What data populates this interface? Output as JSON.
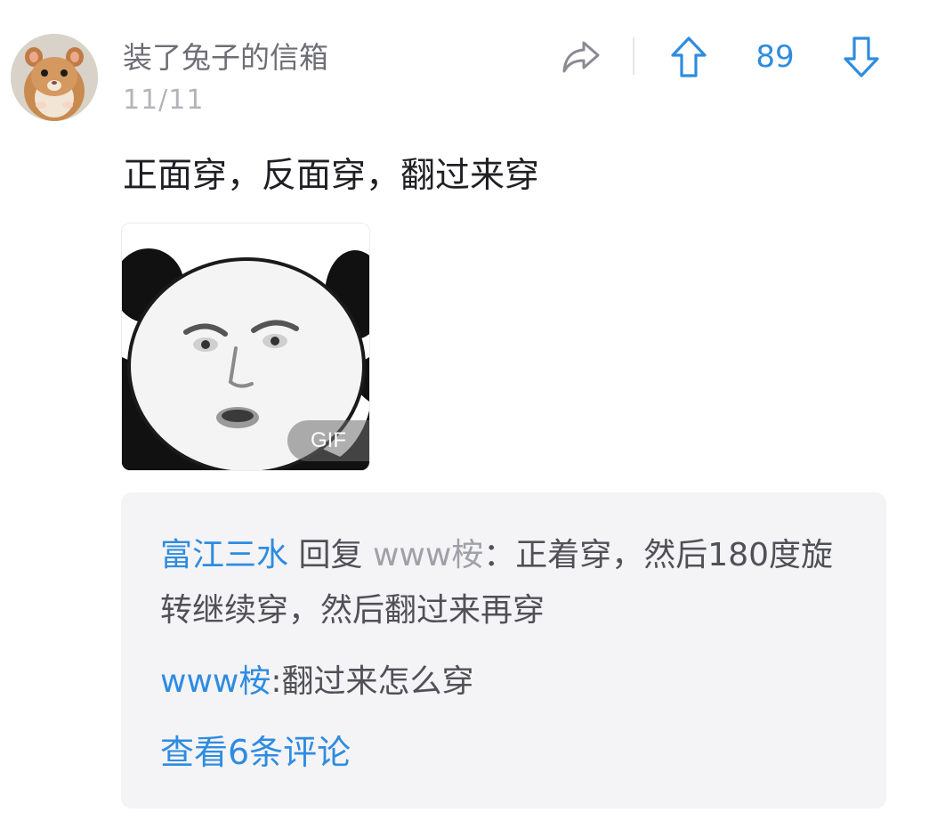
{
  "post": {
    "author": "装了兔子的信箱",
    "date": "11/11",
    "content": "正面穿，反面穿，翻过来穿",
    "avatar_icon": "hamster-avatar",
    "media": {
      "badge": "GIF",
      "icon": "panda-meme-gif"
    }
  },
  "actions": {
    "share_icon": "share-icon",
    "upvote_icon": "arrow-up-icon",
    "vote_count": "89",
    "downvote_icon": "arrow-down-icon"
  },
  "comments": {
    "reply": {
      "author": "富江三水",
      "verb": "回复",
      "target": "www桉",
      "separator": "：",
      "text": "正着穿，然后180度旋转继续穿，然后翻过来再穿"
    },
    "comment": {
      "author": "www桉",
      "separator": ":",
      "text": "翻过来怎么穿"
    },
    "view_more": "查看6条评论"
  },
  "colors": {
    "accent": "#2e8ce0",
    "username": "#6e6e76",
    "date": "#b4b4bb",
    "content": "#1f1f24",
    "comment_bg": "#f4f4f6"
  }
}
